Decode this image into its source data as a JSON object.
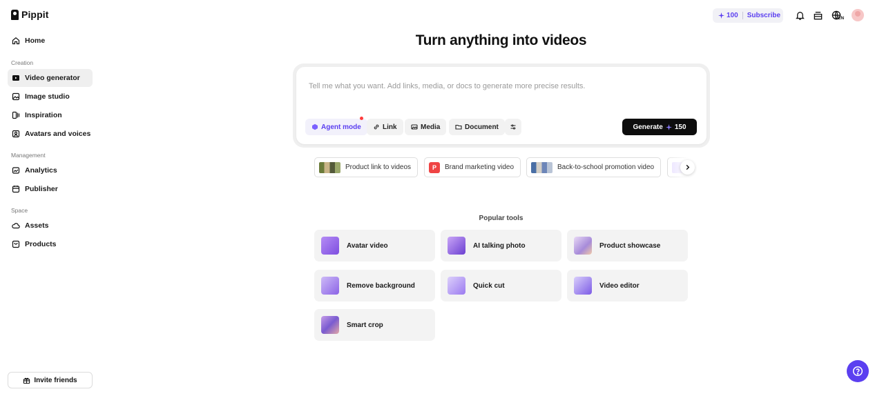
{
  "brand": {
    "name": "Pippit"
  },
  "sidebar": {
    "home": "Home",
    "sections": [
      {
        "label": "Creation",
        "items": [
          {
            "label": "Video generator",
            "icon": "video-generator-icon",
            "active": true
          },
          {
            "label": "Image studio",
            "icon": "image-studio-icon"
          },
          {
            "label": "Inspiration",
            "icon": "inspiration-icon"
          },
          {
            "label": "Avatars and voices",
            "icon": "avatar-icon"
          }
        ]
      },
      {
        "label": "Management",
        "items": [
          {
            "label": "Analytics",
            "icon": "analytics-icon"
          },
          {
            "label": "Publisher",
            "icon": "calendar-icon"
          }
        ]
      },
      {
        "label": "Space",
        "items": [
          {
            "label": "Assets",
            "icon": "cloud-icon"
          },
          {
            "label": "Products",
            "icon": "bag-icon"
          }
        ]
      }
    ],
    "invite": "Invite friends"
  },
  "topbar": {
    "credits": "100",
    "subscribe": "Subscribe",
    "lang": "EN"
  },
  "main": {
    "headline": "Turn anything into videos",
    "prompt_placeholder": "Tell me what you want. Add links, media, or docs to generate more precise results.",
    "chips": {
      "agent": "Agent mode",
      "link": "Link",
      "media": "Media",
      "document": "Document"
    },
    "generate": {
      "label": "Generate",
      "cost": "150"
    },
    "suggestions": [
      "Product link to videos",
      "Brand marketing video",
      "Back-to-school promotion video"
    ],
    "suggestion_badge": "P",
    "popular_label": "Popular tools",
    "tools": [
      "Avatar video",
      "AI talking photo",
      "Product showcase",
      "Remove background",
      "Quick cut",
      "Video editor",
      "Smart crop"
    ]
  },
  "colors": {
    "accent": "#5b3ff0",
    "notification_dot": "#ff3b3b"
  }
}
